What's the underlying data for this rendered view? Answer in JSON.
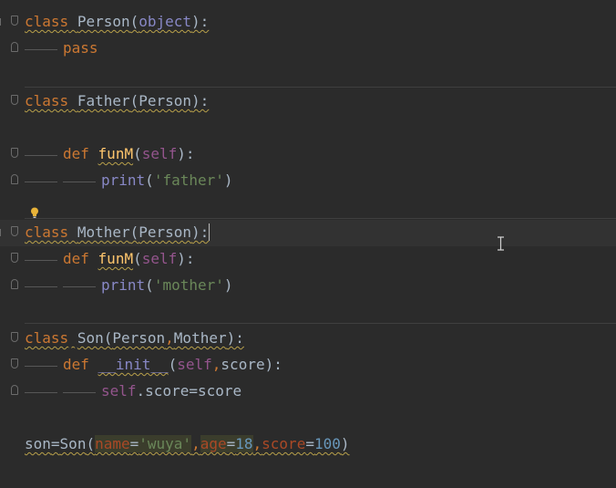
{
  "editor": {
    "language": "Python",
    "colors": {
      "background": "#2b2b2b",
      "keyword": "#cc7832",
      "function": "#ffc66d",
      "self": "#94558d",
      "builtin": "#8888c6",
      "string": "#6a8759",
      "number": "#6897bb",
      "warning_underline": "#b8a04a"
    },
    "tokens": {
      "class": "class",
      "def": "def",
      "pass": "pass",
      "self": "self",
      "print": "print",
      "object": "object",
      "person": "Person",
      "father": "Father",
      "mother": "Mother",
      "son": "Son",
      "funM": "funM",
      "init": "__init__",
      "score": "score",
      "str_father": "'father'",
      "str_mother": "'mother'",
      "son_var": "son",
      "name_kw": "name",
      "str_wuya": "'wuya'",
      "age_kw": "age",
      "num_18": "18",
      "score_kw": "score",
      "num_100": "100"
    },
    "icons": {
      "intention": "lightbulb-icon",
      "cursor": "text-cursor-icon",
      "fold": "fold-marker-icon"
    }
  }
}
